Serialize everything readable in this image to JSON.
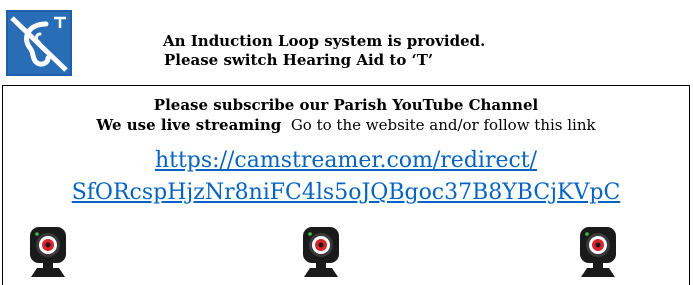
{
  "notice": {
    "icon": "hearing-loop-icon",
    "line1": "An Induction Loop system is provided.",
    "line2": "Please switch Hearing Aid to ‘T’"
  },
  "stream": {
    "heading": "Please subscribe our Parish YouTube Channel",
    "live_bold": "We use live streaming",
    "live_rest": "Go to the website and/or follow this link",
    "link_line1": "https://camstreamer.com/redirect/",
    "link_line2": "SfORcspHjzNr8niFC4ls5oJQBgoc37B8YBCjKVpC",
    "link_color": "#0563c1",
    "camera_icon": "webcam-icon",
    "camera_count": 3
  }
}
